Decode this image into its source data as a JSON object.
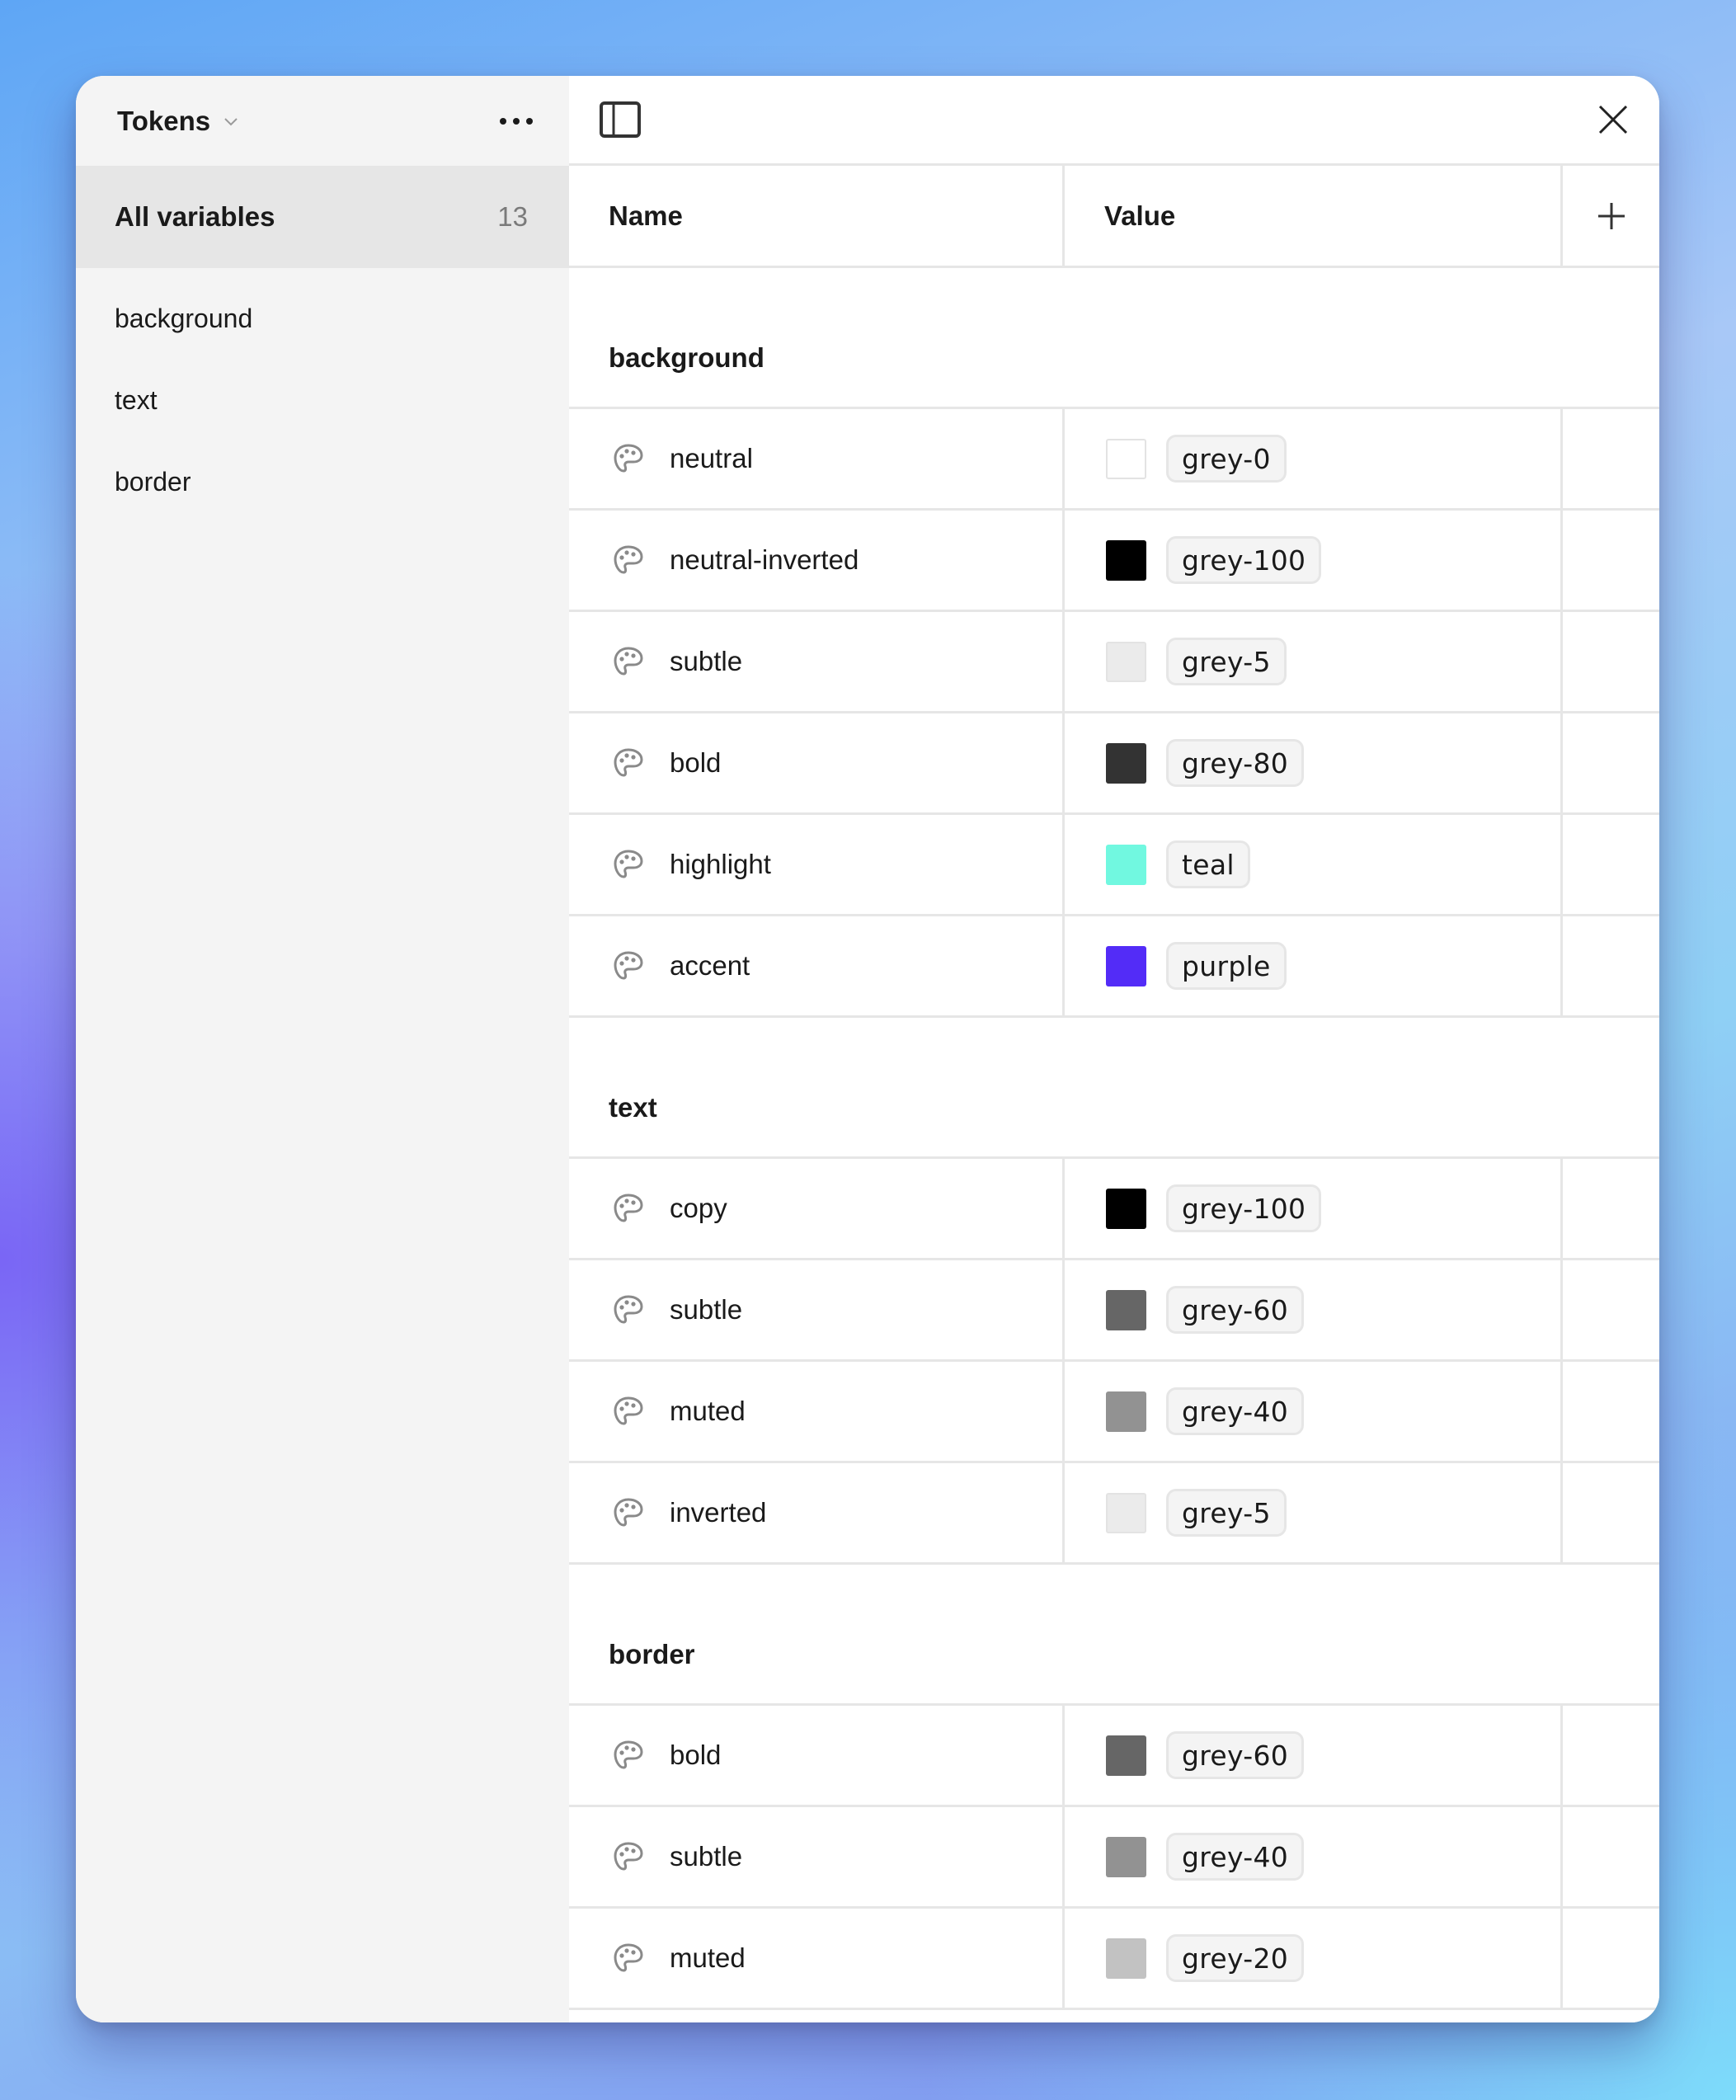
{
  "sidebar": {
    "collection_title": "Tokens",
    "all_variables": {
      "label": "All variables",
      "count": "13"
    },
    "groups": [
      {
        "label": "background"
      },
      {
        "label": "text"
      },
      {
        "label": "border"
      }
    ]
  },
  "table": {
    "columns": {
      "name": "Name",
      "value": "Value"
    },
    "groups": [
      {
        "title": "background",
        "rows": [
          {
            "name": "neutral",
            "value": "grey-0",
            "color": "#ffffff",
            "light": true
          },
          {
            "name": "neutral-inverted",
            "value": "grey-100",
            "color": "#000000",
            "light": false
          },
          {
            "name": "subtle",
            "value": "grey-5",
            "color": "#ebebeb",
            "light": true
          },
          {
            "name": "bold",
            "value": "grey-80",
            "color": "#333333",
            "light": false
          },
          {
            "name": "highlight",
            "value": "teal",
            "color": "#71f8e0",
            "light": false
          },
          {
            "name": "accent",
            "value": "purple",
            "color": "#532cf7",
            "light": false
          }
        ]
      },
      {
        "title": "text",
        "rows": [
          {
            "name": "copy",
            "value": "grey-100",
            "color": "#000000",
            "light": false
          },
          {
            "name": "subtle",
            "value": "grey-60",
            "color": "#666666",
            "light": false
          },
          {
            "name": "muted",
            "value": "grey-40",
            "color": "#929292",
            "light": false
          },
          {
            "name": "inverted",
            "value": "grey-5",
            "color": "#ebebeb",
            "light": true
          }
        ]
      },
      {
        "title": "border",
        "rows": [
          {
            "name": "bold",
            "value": "grey-60",
            "color": "#666666",
            "light": false
          },
          {
            "name": "subtle",
            "value": "grey-40",
            "color": "#929292",
            "light": false
          },
          {
            "name": "muted",
            "value": "grey-20",
            "color": "#c2c2c2",
            "light": false
          }
        ]
      }
    ]
  },
  "icons": {
    "collection_dropdown": "chevron-down-icon",
    "more": "more-horizontal-icon",
    "sidebar_toggle": "sidebar-toggle-icon",
    "close": "close-icon",
    "add": "plus-icon",
    "variable_type": "palette-icon"
  }
}
